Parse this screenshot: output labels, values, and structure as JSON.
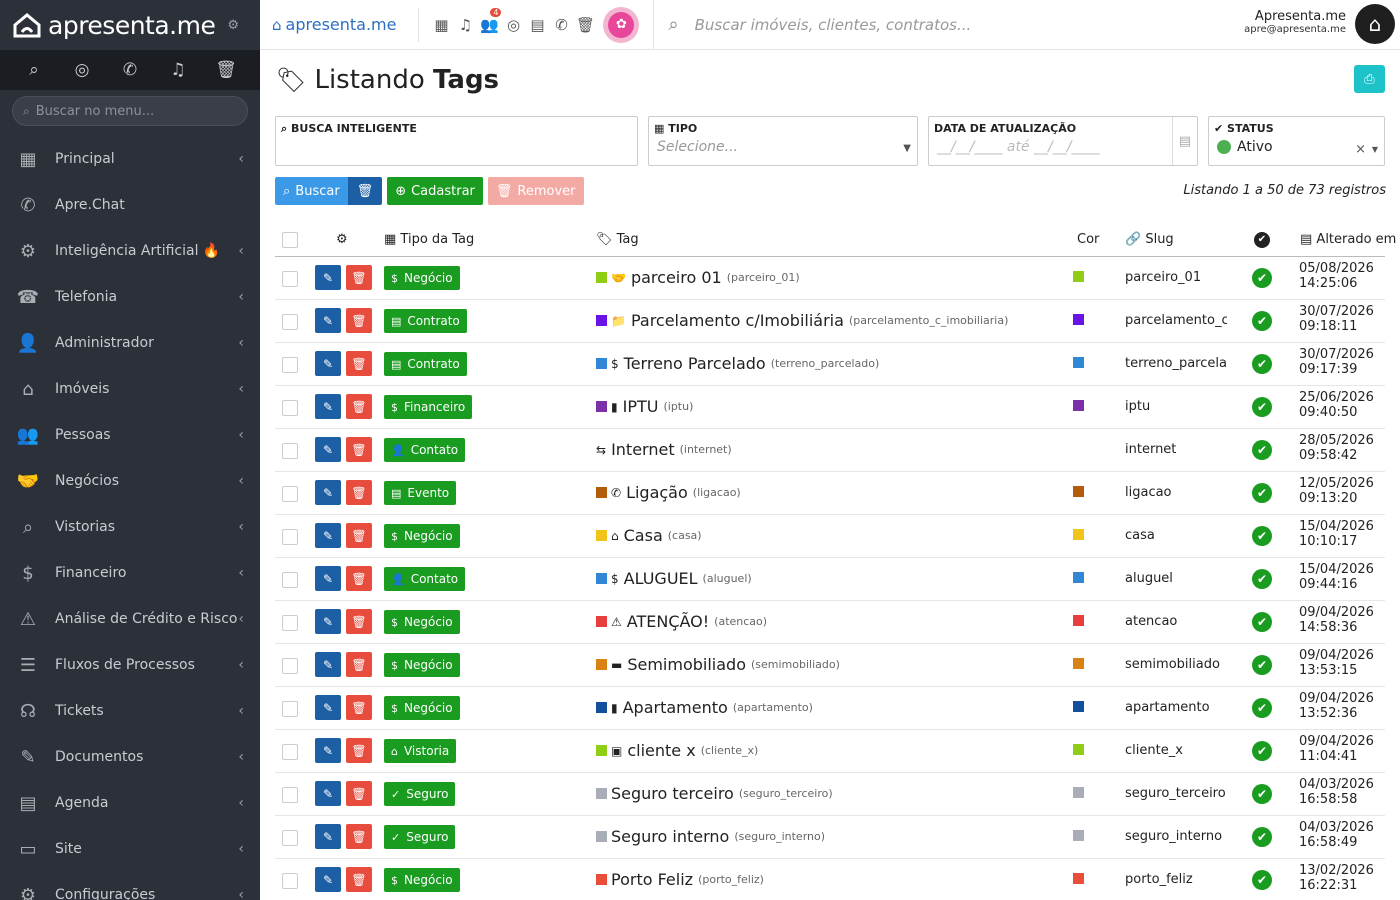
{
  "sidebar": {
    "logo": "apresenta.me",
    "search_placeholder": "Buscar no menu...",
    "items": [
      {
        "label": "Principal",
        "icon": "dashboard-icon",
        "glyph": "▦",
        "chev": true
      },
      {
        "label": "Apre.Chat",
        "icon": "whatsapp-icon",
        "glyph": "✆",
        "chev": false
      },
      {
        "label": "Inteligência Artificial 🔥",
        "icon": "robot-icon",
        "glyph": "⚙",
        "chev": true
      },
      {
        "label": "Telefonia",
        "icon": "phone-icon",
        "glyph": "☎",
        "chev": true
      },
      {
        "label": "Administrador",
        "icon": "user-tie-icon",
        "glyph": "👤",
        "chev": true
      },
      {
        "label": "Imóveis",
        "icon": "home-icon",
        "glyph": "⌂",
        "chev": true
      },
      {
        "label": "Pessoas",
        "icon": "people-icon",
        "glyph": "👥",
        "chev": true
      },
      {
        "label": "Negócios",
        "icon": "handshake-icon",
        "glyph": "🤝",
        "chev": true
      },
      {
        "label": "Vistorias",
        "icon": "inspection-icon",
        "glyph": "⌕",
        "chev": true
      },
      {
        "label": "Financeiro",
        "icon": "dollar-icon",
        "glyph": "$",
        "chev": true
      },
      {
        "label": "Análise de Crédito e Risco",
        "icon": "warning-icon",
        "glyph": "⚠",
        "chev": true
      },
      {
        "label": "Fluxos de Processos",
        "icon": "filter-icon",
        "glyph": "☰",
        "chev": true
      },
      {
        "label": "Tickets",
        "icon": "headset-icon",
        "glyph": "☊",
        "chev": true
      },
      {
        "label": "Documentos",
        "icon": "document-edit-icon",
        "glyph": "✎",
        "chev": true
      },
      {
        "label": "Agenda",
        "icon": "calendar-icon",
        "glyph": "▤",
        "chev": true
      },
      {
        "label": "Site",
        "icon": "browser-icon",
        "glyph": "▭",
        "chev": true
      },
      {
        "label": "Configurações",
        "icon": "gears-icon",
        "glyph": "⚙",
        "chev": true
      }
    ]
  },
  "topbar": {
    "logo": "apresenta.me",
    "notification_badge": "4",
    "search_placeholder": "Buscar imóveis, clientes, contratos...",
    "user_name": "Apresenta.me",
    "user_email": "apre@apresenta.me"
  },
  "page": {
    "title_prefix": "Listando ",
    "title_bold": "Tags",
    "filters": {
      "smart": {
        "label": "BUSCA INTELIGENTE",
        "value": ""
      },
      "tipo": {
        "label": "TIPO",
        "placeholder": "Selecione..."
      },
      "data": {
        "label": "DATA DE ATUALIZAÇÃO",
        "value": "__/__/____  até  __/__/____"
      },
      "status": {
        "label": "STATUS",
        "value": "Ativo"
      }
    },
    "buttons": {
      "search": "Buscar",
      "create": "Cadastrar",
      "remove": "Remover"
    },
    "list_info": "Listando 1 a 50 de 73 registros",
    "columns": {
      "type": "Tipo da Tag",
      "tag": "Tag",
      "color": "Cor",
      "slug": "Slug",
      "updated": "Alterado em"
    }
  },
  "rows": [
    {
      "type": "Negócio",
      "type_icon": "$",
      "tag": "parceiro 01",
      "slug_small": "(parceiro_01)",
      "slug": "parceiro_01",
      "color": "#8fce15",
      "glyph": "🤝",
      "date": "05/08/2026",
      "time": "14:25:06"
    },
    {
      "type": "Contrato",
      "type_icon": "▤",
      "tag": "Parcelamento c/Imobiliária",
      "slug_small": "(parcelamento_c_imobiliaria)",
      "slug": "parcelamento_c",
      "color": "#6a13e6",
      "glyph": "📁",
      "date": "30/07/2026",
      "time": "09:18:11"
    },
    {
      "type": "Contrato",
      "type_icon": "▤",
      "tag": "Terreno Parcelado",
      "slug_small": "(terreno_parcelado)",
      "slug": "terreno_parcela",
      "color": "#2f87d6",
      "glyph": "$",
      "date": "30/07/2026",
      "time": "09:17:39"
    },
    {
      "type": "Financeiro",
      "type_icon": "$",
      "tag": "IPTU",
      "slug_small": "(iptu)",
      "slug": "iptu",
      "color": "#7b2fa8",
      "glyph": "▮",
      "date": "25/06/2026",
      "time": "09:40:50"
    },
    {
      "type": "Contato",
      "type_icon": "👤",
      "tag": "Internet",
      "slug_small": "(internet)",
      "slug": "internet",
      "color": "",
      "glyph": "⇆",
      "date": "28/05/2026",
      "time": "09:58:42"
    },
    {
      "type": "Evento",
      "type_icon": "▤",
      "tag": "Ligação",
      "slug_small": "(ligacao)",
      "slug": "ligacao",
      "color": "#b35c0c",
      "glyph": "✆",
      "date": "12/05/2026",
      "time": "09:13:20"
    },
    {
      "type": "Negócio",
      "type_icon": "$",
      "tag": "Casa",
      "slug_small": "(casa)",
      "slug": "casa",
      "color": "#f0c419",
      "glyph": "⌂",
      "date": "15/04/2026",
      "time": "10:10:17"
    },
    {
      "type": "Contato",
      "type_icon": "👤",
      "tag": "ALUGUEL",
      "slug_small": "(aluguel)",
      "slug": "aluguel",
      "color": "#2f87d6",
      "glyph": "$",
      "date": "15/04/2026",
      "time": "09:44:16"
    },
    {
      "type": "Negócio",
      "type_icon": "$",
      "tag": "ATENÇÃO!",
      "slug_small": "(atencao)",
      "slug": "atencao",
      "color": "#e83e3e",
      "glyph": "⚠",
      "date": "09/04/2026",
      "time": "14:58:36"
    },
    {
      "type": "Negócio",
      "type_icon": "$",
      "tag": "Semimobiliado",
      "slug_small": "(semimobiliado)",
      "slug": "semimobiliado",
      "color": "#d98212",
      "glyph": "▬",
      "date": "09/04/2026",
      "time": "13:53:15"
    },
    {
      "type": "Negócio",
      "type_icon": "$",
      "tag": "Apartamento",
      "slug_small": "(apartamento)",
      "slug": "apartamento",
      "color": "#124f9c",
      "glyph": "▮",
      "date": "09/04/2026",
      "time": "13:52:36"
    },
    {
      "type": "Vistoria",
      "type_icon": "⌂",
      "tag": "cliente x",
      "slug_small": "(cliente_x)",
      "slug": "cliente_x",
      "color": "#8fce15",
      "glyph": "▣",
      "date": "09/04/2026",
      "time": "11:04:41"
    },
    {
      "type": "Seguro",
      "type_icon": "✓",
      "tag": "Seguro terceiro",
      "slug_small": "(seguro_terceiro)",
      "slug": "seguro_terceiro",
      "color": "#a8adb7",
      "glyph": "",
      "date": "04/03/2026",
      "time": "16:58:58"
    },
    {
      "type": "Seguro",
      "type_icon": "✓",
      "tag": "Seguro interno",
      "slug_small": "(seguro_interno)",
      "slug": "seguro_interno",
      "color": "#a8adb7",
      "glyph": "",
      "date": "04/03/2026",
      "time": "16:58:49"
    },
    {
      "type": "Negócio",
      "type_icon": "$",
      "tag": "Porto Feliz",
      "slug_small": "(porto_feliz)",
      "slug": "porto_feliz",
      "color": "#e84e3a",
      "glyph": "",
      "date": "13/02/2026",
      "time": "16:22:31"
    }
  ]
}
